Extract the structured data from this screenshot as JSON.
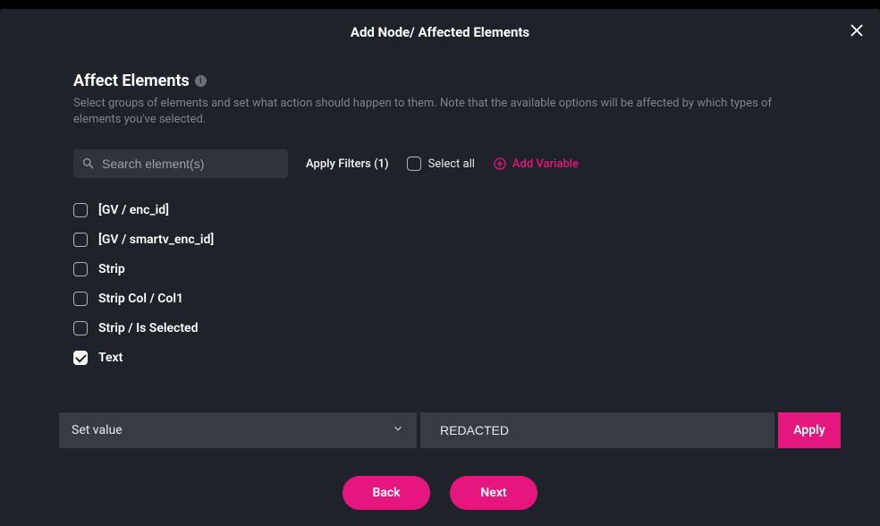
{
  "dialog": {
    "title": "Add Node/ Affected Elements",
    "close_label": "Close"
  },
  "section": {
    "title": "Affect Elements",
    "description": "Select groups of elements and set what action should happen to them. Note that the available options will be affected by which types of elements you've selected."
  },
  "toolbar": {
    "search_placeholder": "Search element(s)",
    "filters_label": "Apply Filters (1)",
    "select_all_label": "Select all",
    "add_variable_label": "Add Variable"
  },
  "elements": [
    {
      "label": "[GV / enc_id]",
      "checked": false
    },
    {
      "label": "[GV / smartv_enc_id]",
      "checked": false
    },
    {
      "label": "Strip",
      "checked": false
    },
    {
      "label": "Strip Col / Col1",
      "checked": false
    },
    {
      "label": "Strip / Is Selected",
      "checked": false
    },
    {
      "label": "Text",
      "checked": true
    }
  ],
  "action": {
    "select_label": "Set value",
    "value": "REDACTED",
    "apply_label": "Apply"
  },
  "nav": {
    "back_label": "Back",
    "next_label": "Next"
  },
  "colors": {
    "accent": "#e5177e",
    "bg_dialog": "#1f2329",
    "bg_field": "#373c44"
  }
}
